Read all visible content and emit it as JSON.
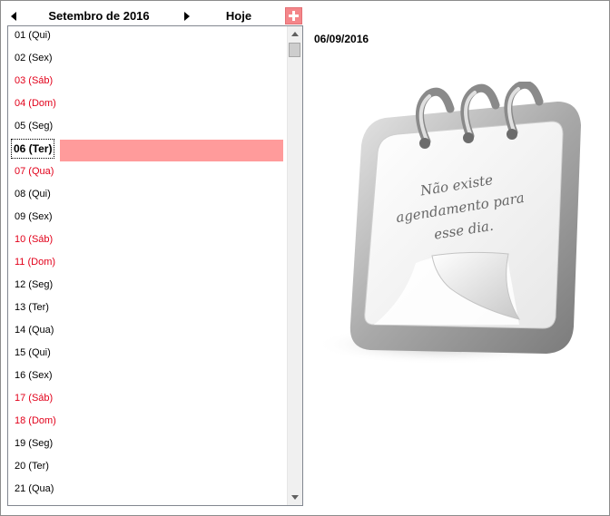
{
  "header": {
    "month_title": "Setembro  de 2016",
    "today_label": "Hoje",
    "prev_icon": "caret-left-icon",
    "next_icon": "caret-right-icon",
    "add_icon": "plus-icon"
  },
  "colors": {
    "accent": "#f4868a",
    "selection_bar": "#ff9b9b",
    "weekend_text": "#e2001a"
  },
  "days": [
    {
      "label": "01 (Qui)",
      "weekend": false
    },
    {
      "label": "02 (Sex)",
      "weekend": false
    },
    {
      "label": "03 (Sáb)",
      "weekend": true
    },
    {
      "label": "04 (Dom)",
      "weekend": true
    },
    {
      "label": "05 (Seg)",
      "weekend": false
    },
    {
      "label": "06 (Ter)",
      "weekend": false,
      "selected": true
    },
    {
      "label": "07 (Qua)",
      "weekend": true
    },
    {
      "label": "08 (Qui)",
      "weekend": false
    },
    {
      "label": "09 (Sex)",
      "weekend": false
    },
    {
      "label": "10 (Sáb)",
      "weekend": true
    },
    {
      "label": "11 (Dom)",
      "weekend": true
    },
    {
      "label": "12 (Seg)",
      "weekend": false
    },
    {
      "label": "13 (Ter)",
      "weekend": false
    },
    {
      "label": "14 (Qua)",
      "weekend": false
    },
    {
      "label": "15 (Qui)",
      "weekend": false
    },
    {
      "label": "16 (Sex)",
      "weekend": false
    },
    {
      "label": "17 (Sáb)",
      "weekend": true
    },
    {
      "label": "18 (Dom)",
      "weekend": true
    },
    {
      "label": "19 (Seg)",
      "weekend": false
    },
    {
      "label": "20 (Ter)",
      "weekend": false
    },
    {
      "label": "21 (Qua)",
      "weekend": false
    }
  ],
  "detail": {
    "selected_date": "06/09/2016",
    "empty_message": "Não existe agendamento para esse dia."
  }
}
